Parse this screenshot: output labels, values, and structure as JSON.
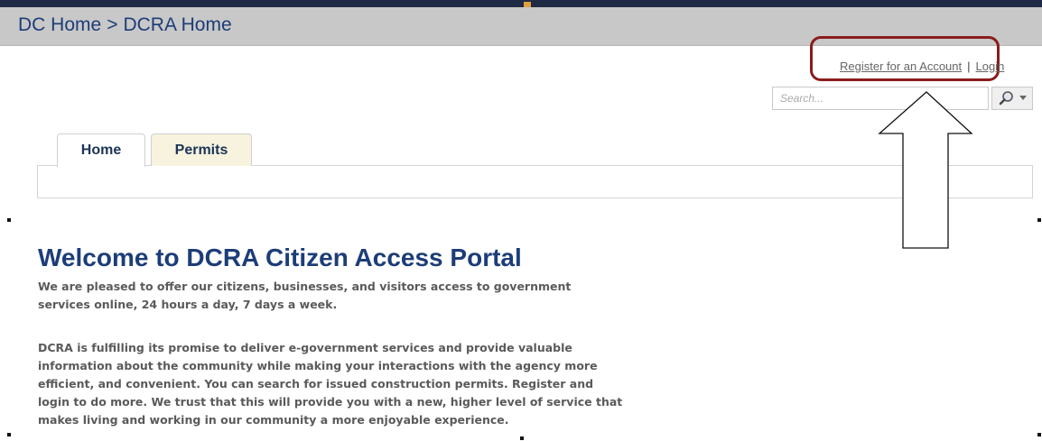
{
  "breadcrumb": {
    "item1": "DC Home",
    "separator": ">",
    "item2": "DCRA Home"
  },
  "account_links": {
    "register": "Register for an Account",
    "separator": "|",
    "login": "Login"
  },
  "search": {
    "placeholder": "Search...",
    "search_icon": "magnifier-icon",
    "dropdown_icon": "caret-down-icon"
  },
  "tabs": [
    {
      "label": "Home",
      "selected": true
    },
    {
      "label": "Permits",
      "selected": false
    }
  ],
  "main": {
    "heading": "Welcome to DCRA Citizen Access Portal",
    "paragraph1_lines": [
      "We are pleased to offer our citizens, businesses, and visitors access to government",
      "services online, 24 hours a day, 7 days a week."
    ],
    "paragraph2_lines": [
      "DCRA is fulfilling its promise to deliver e-government services and provide valuable",
      "information about the community while making your interactions with the agency more",
      "efficient, and convenient. You can search for issued construction permits. Register and",
      "login to do more. We trust that this will provide you with a new, higher level of service that",
      "makes living and working in our community a more enjoyable experience."
    ]
  },
  "annotation": {
    "highlight_color": "#8a1c1c",
    "arrow_icon": "up-arrow-icon"
  },
  "colors": {
    "link_blue": "#1c3d78",
    "tab_inactive": "#f7f3de",
    "header_gray": "#c8c8c8"
  }
}
